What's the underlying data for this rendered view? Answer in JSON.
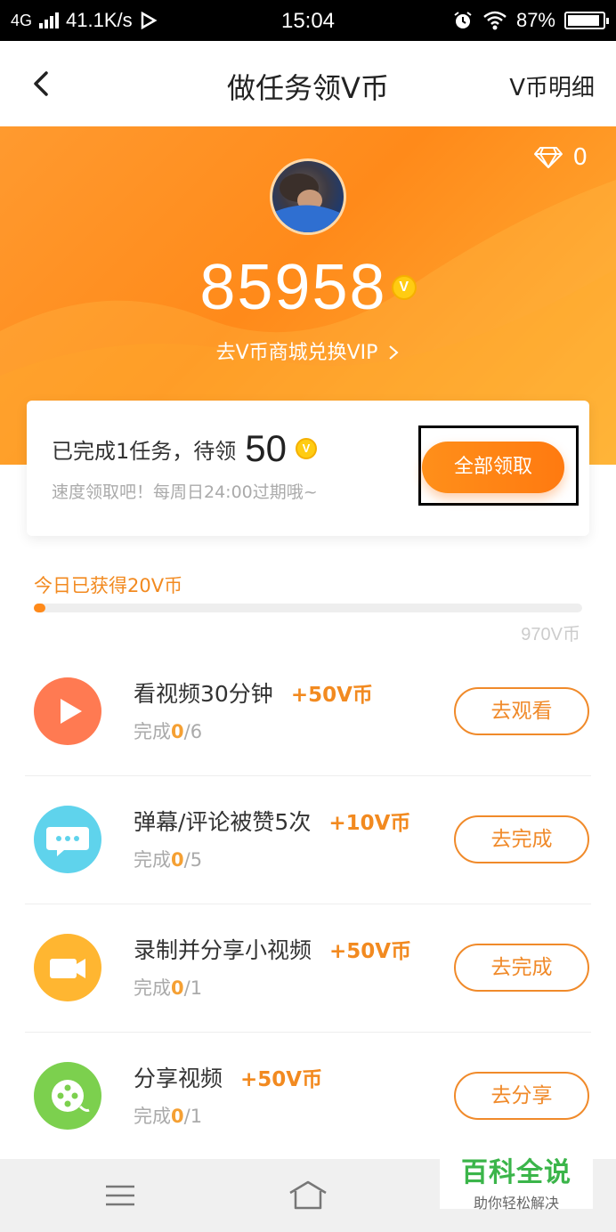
{
  "status_bar": {
    "network": "4G",
    "speed": "41.1K/s",
    "time": "15:04",
    "battery": "87%",
    "battery_level": 0.87
  },
  "nav": {
    "title": "做任务领V币",
    "right_link": "V币明细"
  },
  "hero": {
    "diamond_count": "0",
    "coins": "85958",
    "coin_badge": "V",
    "mall_link": "去V币商城兑换VIP"
  },
  "claim_card": {
    "completed_text": "已完成1任务，待领",
    "pending_amount": "50",
    "note": "速度领取吧！每周日24:00过期哦~",
    "button": "全部领取"
  },
  "today": {
    "label": "今日已获得20V币",
    "earned": 20,
    "max_label": "970V币",
    "max": 970
  },
  "tasks": [
    {
      "icon": "play-icon",
      "color": "#ff7a52",
      "title": "看视频30分钟",
      "reward": "+50V币",
      "progress_prefix": "完成",
      "done": "0",
      "total": "/6",
      "button": "去观看"
    },
    {
      "icon": "chat-bubble-icon",
      "color": "#5fd3ec",
      "title": "弹幕/评论被赞5次",
      "reward": "+10V币",
      "progress_prefix": "完成",
      "done": "0",
      "total": "/5",
      "button": "去完成"
    },
    {
      "icon": "video-camera-icon",
      "color": "#ffb631",
      "title": "录制并分享小视频",
      "reward": "+50V币",
      "progress_prefix": "完成",
      "done": "0",
      "total": "/1",
      "button": "去完成"
    },
    {
      "icon": "film-reel-icon",
      "color": "#7cd04e",
      "title": "分享视频",
      "reward": "+50V币",
      "progress_prefix": "完成",
      "done": "0",
      "total": "/1",
      "button": "去分享"
    }
  ],
  "watermark": {
    "main": "百科全说",
    "sub": "助你轻松解决"
  },
  "colors": {
    "accent": "#ff8a1a",
    "reward": "#f28a20"
  }
}
